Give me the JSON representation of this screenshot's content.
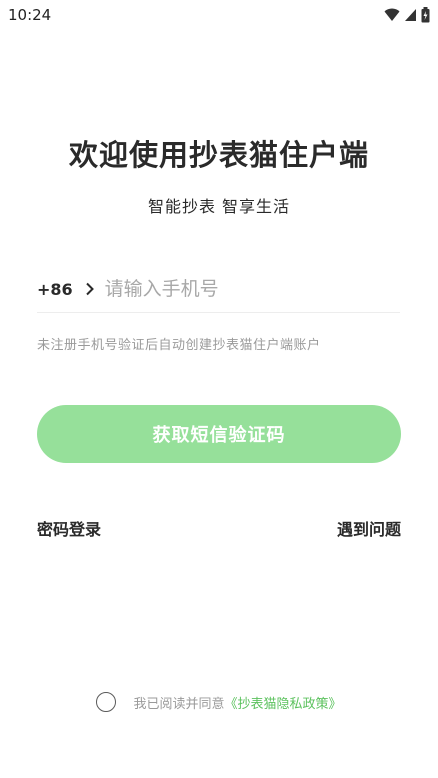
{
  "status_bar": {
    "time": "10:24",
    "icons": [
      "wifi-icon",
      "signal-icon",
      "battery-icon"
    ]
  },
  "header": {
    "title": "欢迎使用抄表猫住户端",
    "subtitle": "智能抄表  智享生活"
  },
  "login_form": {
    "country_code": "+86",
    "phone_placeholder": "请输入手机号",
    "phone_value": "",
    "hint": "未注册手机号验证后自动创建抄表猫住户端账户",
    "sms_button_label": "获取短信验证码"
  },
  "links": {
    "password_login": "密码登录",
    "help": "遇到问题"
  },
  "agreement": {
    "checked": false,
    "text": "我已阅读并同意",
    "policy_link": "《抄表猫隐私政策》"
  },
  "colors": {
    "accent": "#96e09a",
    "link": "#5cc25e"
  }
}
